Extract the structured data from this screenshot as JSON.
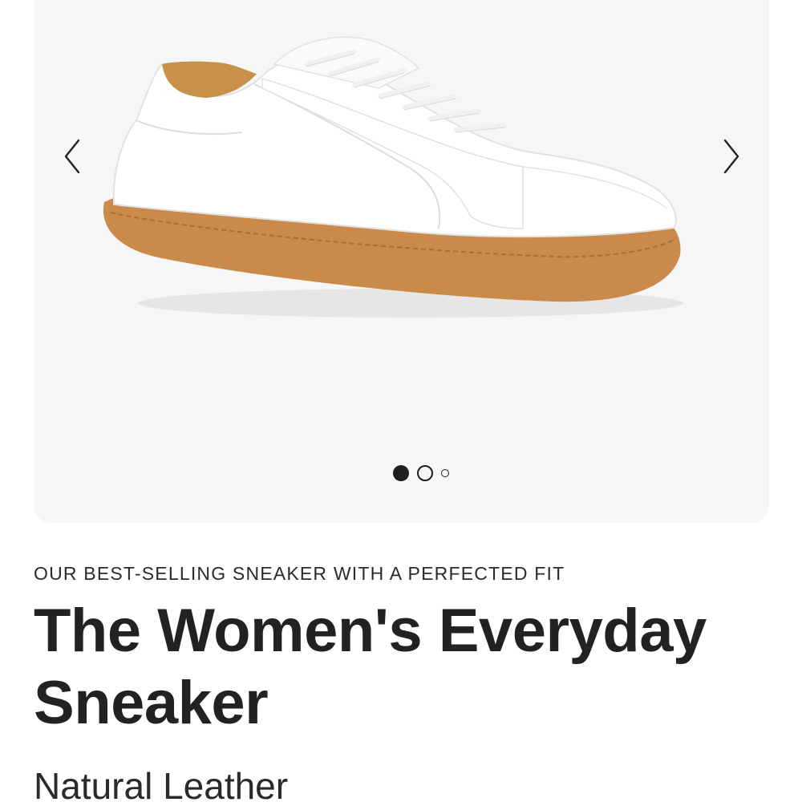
{
  "gallery": {
    "image": {
      "alt": "White leather sneaker with gum sole",
      "shoe_color": "#ffffff",
      "sole_color": "#c98a4a",
      "lining_color": "#c8914a"
    },
    "prev_icon": "chevron-left-icon",
    "next_icon": "chevron-right-icon",
    "dots_count": 3,
    "active_dot": 1,
    "background_color": "#f6f6f6"
  },
  "product": {
    "tagline": "OUR BEST-SELLING SNEAKER WITH A PERFECTED FIT",
    "title": "The Women's Everyday Sneaker",
    "subtitle": "Natural Leather"
  }
}
